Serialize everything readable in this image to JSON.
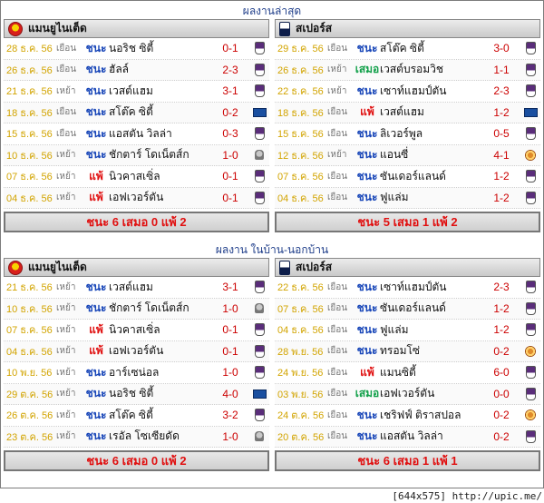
{
  "sections": [
    {
      "title": "ผลงานล่าสุด",
      "teams": [
        {
          "name": "แมนยูไนเต็ด",
          "logo": "man-utd-crest",
          "matches": [
            {
              "date": "28 ธ.ค. 56",
              "venue": "เยือน",
              "result": "ชนะ",
              "rtype": "win",
              "opponent": "นอริช ซิตี้",
              "score": "0-1",
              "comp": "pl"
            },
            {
              "date": "26 ธ.ค. 56",
              "venue": "เยือน",
              "result": "ชนะ",
              "rtype": "win",
              "opponent": "ฮัลล์",
              "score": "2-3",
              "comp": "pl"
            },
            {
              "date": "21 ธ.ค. 56",
              "venue": "เหย้า",
              "result": "ชนะ",
              "rtype": "win",
              "opponent": "เวสต์แฮม",
              "score": "3-1",
              "comp": "pl"
            },
            {
              "date": "18 ธ.ค. 56",
              "venue": "เยือน",
              "result": "ชนะ",
              "rtype": "win",
              "opponent": "สโต๊ค ซิตี้",
              "score": "0-2",
              "comp": "euro"
            },
            {
              "date": "15 ธ.ค. 56",
              "venue": "เยือน",
              "result": "ชนะ",
              "rtype": "win",
              "opponent": "แอสตัน วิลล่า",
              "score": "0-3",
              "comp": "pl"
            },
            {
              "date": "10 ธ.ค. 56",
              "venue": "เหย้า",
              "result": "ชนะ",
              "rtype": "win",
              "opponent": "ชักตาร์ โดเน็ตส์ก",
              "score": "1-0",
              "comp": "cup"
            },
            {
              "date": "07 ธ.ค. 56",
              "venue": "เหย้า",
              "result": "แพ้",
              "rtype": "loss",
              "opponent": "นิวคาสเซิ่ล",
              "score": "0-1",
              "comp": "pl"
            },
            {
              "date": "04 ธ.ค. 56",
              "venue": "เหย้า",
              "result": "แพ้",
              "rtype": "loss",
              "opponent": "เอฟเวอร์ตัน",
              "score": "0-1",
              "comp": "pl"
            }
          ],
          "summary": "ชนะ 6 เสมอ 0 แพ้ 2"
        },
        {
          "name": "สเปอร์ส",
          "logo": "spurs-crest",
          "matches": [
            {
              "date": "29 ธ.ค. 56",
              "venue": "เยือน",
              "result": "ชนะ",
              "rtype": "win",
              "opponent": "สโต๊ค ซิตี้",
              "score": "3-0",
              "comp": "pl"
            },
            {
              "date": "26 ธ.ค. 56",
              "venue": "เหย้า",
              "result": "เสมอ",
              "rtype": "draw",
              "opponent": "เวสต์บรอมวิช",
              "score": "1-1",
              "comp": "pl"
            },
            {
              "date": "22 ธ.ค. 56",
              "venue": "เหย้า",
              "result": "ชนะ",
              "rtype": "win",
              "opponent": "เซาท์แฮมป์ตัน",
              "score": "2-3",
              "comp": "pl"
            },
            {
              "date": "18 ธ.ค. 56",
              "venue": "เยือน",
              "result": "แพ้",
              "rtype": "loss",
              "opponent": "เวสต์แฮม",
              "score": "1-2",
              "comp": "euro"
            },
            {
              "date": "15 ธ.ค. 56",
              "venue": "เยือน",
              "result": "ชนะ",
              "rtype": "win",
              "opponent": "ลิเวอร์พูล",
              "score": "0-5",
              "comp": "pl"
            },
            {
              "date": "12 ธ.ค. 56",
              "venue": "เหย้า",
              "result": "ชนะ",
              "rtype": "win",
              "opponent": "แอนซี่",
              "score": "4-1",
              "comp": "fac"
            },
            {
              "date": "07 ธ.ค. 56",
              "venue": "เยือน",
              "result": "ชนะ",
              "rtype": "win",
              "opponent": "ซันเดอร์แลนด์",
              "score": "1-2",
              "comp": "pl"
            },
            {
              "date": "04 ธ.ค. 56",
              "venue": "เยือน",
              "result": "ชนะ",
              "rtype": "win",
              "opponent": "ฟูแล่ม",
              "score": "1-2",
              "comp": "pl"
            }
          ],
          "summary": "ชนะ 5 เสมอ 1 แพ้ 2"
        }
      ]
    },
    {
      "title": "ผลงาน ในบ้าน-นอกบ้าน",
      "teams": [
        {
          "name": "แมนยูไนเต็ด",
          "logo": "man-utd-crest",
          "matches": [
            {
              "date": "21 ธ.ค. 56",
              "venue": "เหย้า",
              "result": "ชนะ",
              "rtype": "win",
              "opponent": "เวสต์แฮม",
              "score": "3-1",
              "comp": "pl"
            },
            {
              "date": "10 ธ.ค. 56",
              "venue": "เหย้า",
              "result": "ชนะ",
              "rtype": "win",
              "opponent": "ชักตาร์ โดเน็ตส์ก",
              "score": "1-0",
              "comp": "cup"
            },
            {
              "date": "07 ธ.ค. 56",
              "venue": "เหย้า",
              "result": "แพ้",
              "rtype": "loss",
              "opponent": "นิวคาสเซิ่ล",
              "score": "0-1",
              "comp": "pl"
            },
            {
              "date": "04 ธ.ค. 56",
              "venue": "เหย้า",
              "result": "แพ้",
              "rtype": "loss",
              "opponent": "เอฟเวอร์ตัน",
              "score": "0-1",
              "comp": "pl"
            },
            {
              "date": "10 พ.ย. 56",
              "venue": "เหย้า",
              "result": "ชนะ",
              "rtype": "win",
              "opponent": "อาร์เซน่อล",
              "score": "1-0",
              "comp": "pl"
            },
            {
              "date": "29 ต.ค. 56",
              "venue": "เหย้า",
              "result": "ชนะ",
              "rtype": "win",
              "opponent": "นอริช ซิตี้",
              "score": "4-0",
              "comp": "euro"
            },
            {
              "date": "26 ต.ค. 56",
              "venue": "เหย้า",
              "result": "ชนะ",
              "rtype": "win",
              "opponent": "สโต๊ค ซิตี้",
              "score": "3-2",
              "comp": "pl"
            },
            {
              "date": "23 ต.ค. 56",
              "venue": "เหย้า",
              "result": "ชนะ",
              "rtype": "win",
              "opponent": "เรอัล โซเซียดัด",
              "score": "1-0",
              "comp": "cup"
            }
          ],
          "summary": "ชนะ 6 เสมอ 0 แพ้ 2"
        },
        {
          "name": "สเปอร์ส",
          "logo": "spurs-crest",
          "matches": [
            {
              "date": "22 ธ.ค. 56",
              "venue": "เยือน",
              "result": "ชนะ",
              "rtype": "win",
              "opponent": "เซาท์แฮมป์ตัน",
              "score": "2-3",
              "comp": "pl"
            },
            {
              "date": "07 ธ.ค. 56",
              "venue": "เยือน",
              "result": "ชนะ",
              "rtype": "win",
              "opponent": "ซันเดอร์แลนด์",
              "score": "1-2",
              "comp": "pl"
            },
            {
              "date": "04 ธ.ค. 56",
              "venue": "เยือน",
              "result": "ชนะ",
              "rtype": "win",
              "opponent": "ฟูแล่ม",
              "score": "1-2",
              "comp": "pl"
            },
            {
              "date": "28 พ.ย. 56",
              "venue": "เยือน",
              "result": "ชนะ",
              "rtype": "win",
              "opponent": "ทรอมโซ่",
              "score": "0-2",
              "comp": "fac"
            },
            {
              "date": "24 พ.ย. 56",
              "venue": "เยือน",
              "result": "แพ้",
              "rtype": "loss",
              "opponent": "แมนซิตี้",
              "score": "6-0",
              "comp": "pl"
            },
            {
              "date": "03 พ.ย. 56",
              "venue": "เยือน",
              "result": "เสมอ",
              "rtype": "draw",
              "opponent": "เอฟเวอร์ตัน",
              "score": "0-0",
              "comp": "pl"
            },
            {
              "date": "24 ต.ค. 56",
              "venue": "เยือน",
              "result": "ชนะ",
              "rtype": "win",
              "opponent": "เชริฟฟ์ ติราสปอล",
              "score": "0-2",
              "comp": "fac"
            },
            {
              "date": "20 ต.ค. 56",
              "venue": "เยือน",
              "result": "ชนะ",
              "rtype": "win",
              "opponent": "แอสตัน วิลล่า",
              "score": "0-2",
              "comp": "pl"
            }
          ],
          "summary": "ชนะ 6 เสมอ 1 แพ้ 1"
        }
      ]
    }
  ],
  "footer": "[644x575] http://upic.me/"
}
